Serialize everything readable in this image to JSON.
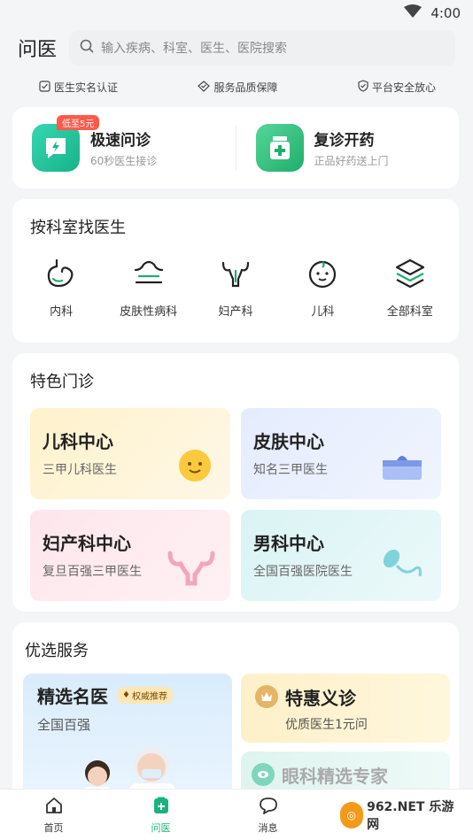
{
  "status": {
    "time": "4:00"
  },
  "header": {
    "title": "问医",
    "search_placeholder": "输入疾病、科室、医生、医院搜索"
  },
  "badges": [
    "医生实名认证",
    "服务品质保障",
    "平台安全放心"
  ],
  "quick": [
    {
      "title": "极速问诊",
      "sub": "60秒医生接诊",
      "tag": "低至5元"
    },
    {
      "title": "复诊开药",
      "sub": "正品好药送上门"
    }
  ],
  "dept_section": {
    "title": "按科室找医生",
    "items": [
      "内科",
      "皮肤性病科",
      "妇产科",
      "儿科",
      "全部科室"
    ]
  },
  "feature_section": {
    "title": "特色门诊",
    "tiles": [
      {
        "title": "儿科中心",
        "sub": "三甲儿科医生"
      },
      {
        "title": "皮肤中心",
        "sub": "知名三甲医生"
      },
      {
        "title": "妇产科中心",
        "sub": "复旦百强三甲医生"
      },
      {
        "title": "男科中心",
        "sub": "全国百强医院医生"
      }
    ]
  },
  "service_section": {
    "title": "优选服务",
    "left": {
      "title": "精选名医",
      "badge": "权威推荐",
      "sub": "全国百强"
    },
    "right_top": {
      "title": "特惠义诊",
      "sub": "优质医生1元问"
    },
    "right_bottom": {
      "title": "眼科精选专家"
    }
  },
  "tabs": [
    "首页",
    "问医",
    "消息"
  ],
  "watermark": "962.NET 乐游网",
  "colors": {
    "accent": "#19b37d",
    "tag_red": "#ff5a4a"
  }
}
